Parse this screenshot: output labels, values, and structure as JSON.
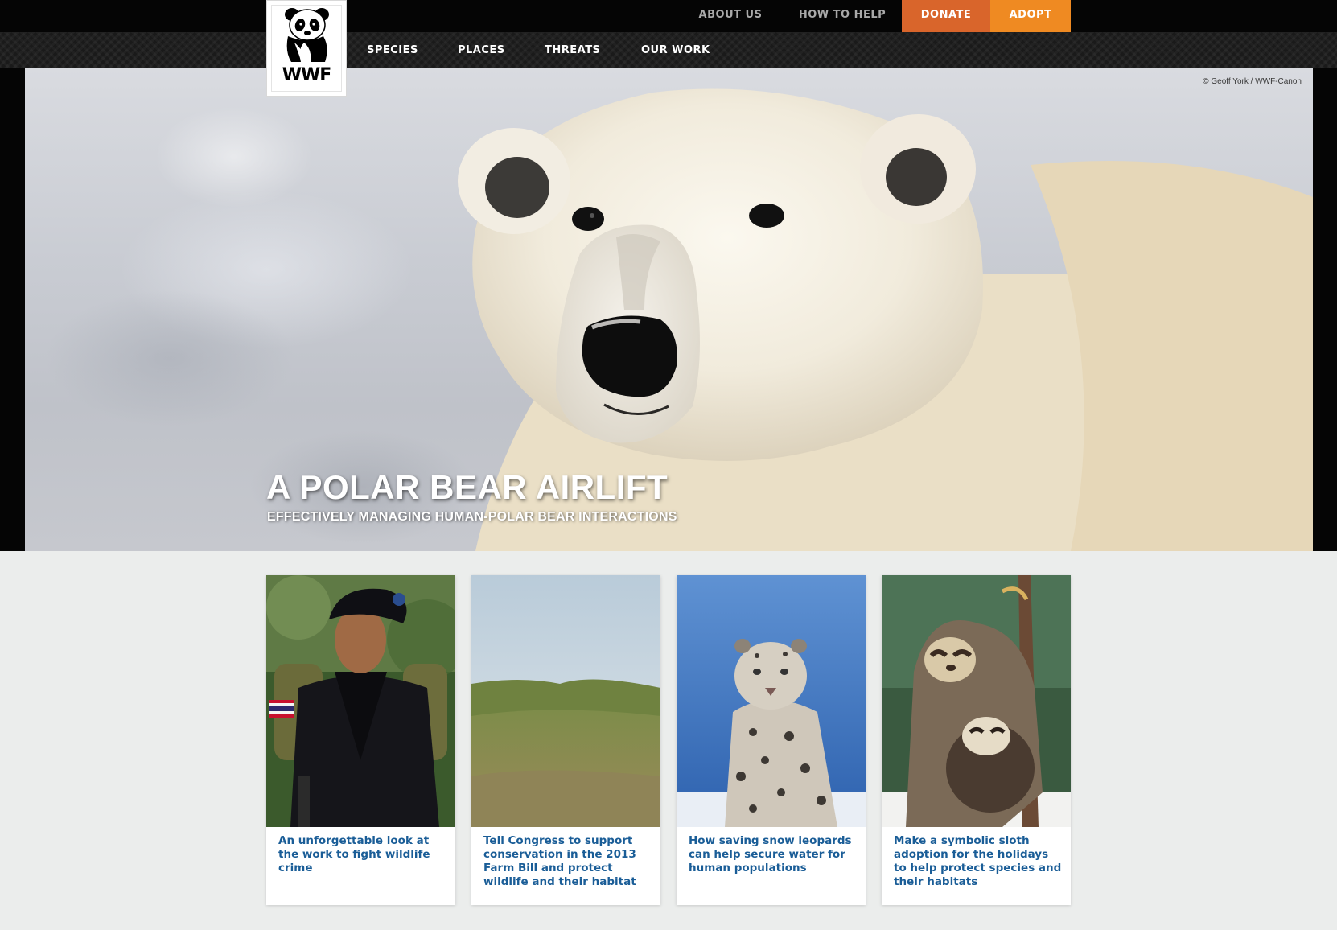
{
  "utility_nav": {
    "about_us": "ABOUT US",
    "how_to_help": "HOW TO HELP",
    "donate": "DONATE",
    "adopt": "ADOPT"
  },
  "main_nav": {
    "species": "SPECIES",
    "places": "PLACES",
    "threats": "THREATS",
    "our_work": "OUR WORK"
  },
  "logo": {
    "wordmark": "WWF",
    "icon": "panda-logo"
  },
  "hero": {
    "title": "A POLAR BEAR AIRLIFT",
    "subtitle": "EFFECTIVELY MANAGING HUMAN-POLAR BEAR INTERACTIONS",
    "credit": "© Geoff York / WWF-Canon",
    "image": "polar-bear-photo"
  },
  "cards": [
    {
      "text": "An unforgettable look at the work to fight wildlife crime",
      "image": "ranger-photo"
    },
    {
      "text": "Tell Congress to support conservation in the 2013 Farm Bill and protect wildlife and their habitat",
      "image": "grassland-photo"
    },
    {
      "text": "How saving snow leopards can help secure water for human populations",
      "image": "snow-leopard-photo"
    },
    {
      "text": "Make a symbolic sloth adoption for the holidays to help protect species and their habitats",
      "image": "sloth-photo"
    }
  ],
  "colors": {
    "donate": "#d9652b",
    "adopt": "#ef8a22",
    "link": "#1a5d97",
    "topbar": "#050505"
  }
}
